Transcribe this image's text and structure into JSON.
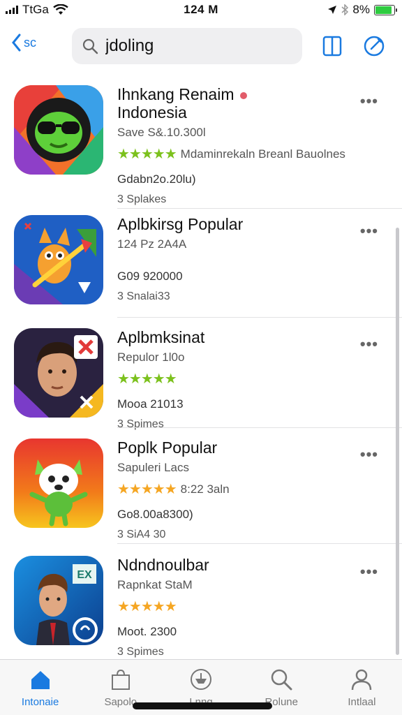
{
  "status_bar": {
    "carrier": "TtGa",
    "time": "124 M",
    "battery": "8%"
  },
  "nav": {
    "back_label": "sc",
    "search_value": "jdoling",
    "book_icon": "book-icon",
    "compose_icon": "compose-icon"
  },
  "apps": [
    {
      "title_line1": "Ihnkang Renaim",
      "title_line2": "Indonesia",
      "subtitle": "Save S&.10.300l",
      "stars": "★★★★★",
      "rating_text": "Mdaminrekaln Breanl Bauolnes",
      "meta1": "Gdabn2o.20lu)",
      "meta2": "3  Splakes",
      "star_color": "green"
    },
    {
      "title_line1": "Aplbkirsg Popular",
      "title_line2": "",
      "subtitle": "124 Pz 2A4A",
      "stars": "",
      "rating_text": "",
      "meta1": "G09 920000",
      "meta2": "3  Snalai33",
      "star_color": "green"
    },
    {
      "title_line1": "Aplbmksinat",
      "title_line2": "",
      "subtitle": "Repulor 1l0o",
      "stars": "★★★★★",
      "rating_text": "",
      "meta1": "Mooa 21013",
      "meta2": "3  Spimes",
      "star_color": "green"
    },
    {
      "title_line1": "Poplk Popular",
      "title_line2": "",
      "subtitle": "Sapuleri Lacs",
      "stars": "★★★★★",
      "rating_text": "8:22 3aln",
      "meta1": "Go8.00a8300)",
      "meta2": "3  SiA4 30",
      "star_color": "orange"
    },
    {
      "title_line1": "Ndndnoulbar",
      "title_line2": "",
      "subtitle": "Rapnkat StaM",
      "stars": "★★★★★",
      "rating_text": "",
      "meta1": "Moot. 2300",
      "meta2": "3  Spimes",
      "star_color": "orange"
    }
  ],
  "more_label": "•••",
  "tabs": [
    {
      "label": "Intonaie",
      "active": true
    },
    {
      "label": "Sapolo",
      "active": false
    },
    {
      "label": "Lnng",
      "active": false
    },
    {
      "label": "Rolune",
      "active": false
    },
    {
      "label": "Intlaal",
      "active": false
    }
  ]
}
